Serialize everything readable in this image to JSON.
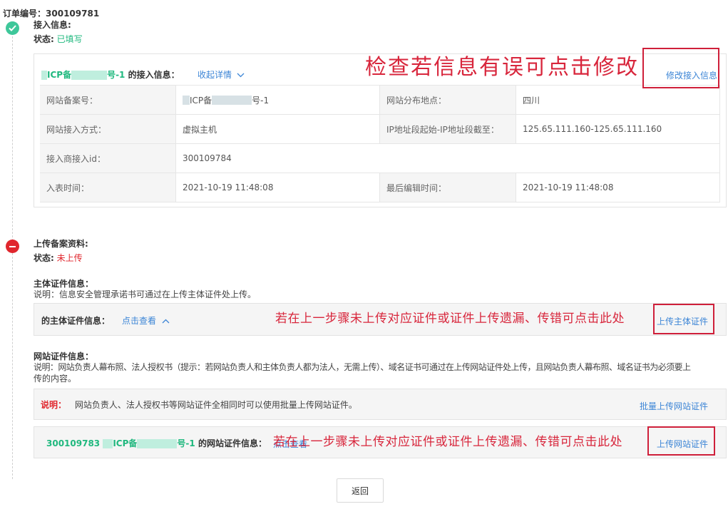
{
  "order": {
    "label": "订单编号：",
    "number": "300109781"
  },
  "step1": {
    "title": "接入信息:",
    "status_label": "状态:",
    "status_value": "已填写",
    "annotation": "检查若信息有误可点击修改",
    "edit_link": "修改接入信息",
    "panel": {
      "title_prefix": "ICP备",
      "title_mid": "号-1",
      "title_suffix": " 的接入信息：",
      "toggle": "收起详情"
    },
    "table": [
      {
        "l1": "网站备案号：",
        "v1a": "ICP备",
        "v1b": "号-1",
        "l2": "网站分布地点：",
        "v2": "四川"
      },
      {
        "l1": "网站接入方式：",
        "v1": "虚拟主机",
        "l2": "IP地址段起始-IP地址段截至：",
        "v2": "125.65.111.160-125.65.111.160"
      },
      {
        "l1": "接入商接入id：",
        "v1": "300109784"
      },
      {
        "l1": "入表时间：",
        "v1": "2021-10-19 11:48:08",
        "l2": "最后编辑时间：",
        "v2": "2021-10-19 11:48:08"
      }
    ]
  },
  "step2": {
    "title": "上传备案资料:",
    "status_label": "状态:",
    "status_value": "未上传",
    "subject": {
      "title": "主体证件信息：",
      "desc": "说明：信息安全管理承诺书可通过在上传主体证件处上传。",
      "row_label": "的主体证件信息：",
      "toggle": "点击查看",
      "annotation": "若在上一步骤未上传对应证件或证件上传遗漏、传错可点击此处",
      "upload": "上传主体证件"
    },
    "website": {
      "title": "网站证件信息：",
      "desc_line1": "说明：网站负责人幕布照、法人授权书（提示：若网站负责人和主体负责人都为法人，无需上传）、域名证书可通过在上传网站证件处上传，且网站负责人幕布照、域名证书为必须要上",
      "desc_line2": "传的内容。",
      "note_label": "说明：",
      "note_text": "网站负责人、法人授权书等网站证件全相同时可以使用批量上传网站证件。",
      "batch_upload": "批量上传网站证件",
      "row_id": "300109783",
      "row_icp": "ICP备",
      "row_mid": "号-1",
      "row_suffix": " 的网站证件信息：",
      "toggle": "点击查看",
      "annotation": "若在上一步骤未上传对应证件或证件上传遗漏、传错可点击此处",
      "upload": "上传网站证件"
    }
  },
  "back_button": "返回",
  "colors": {
    "accent_green": "#1fb87e",
    "error_red": "#e0262d",
    "link_blue": "#3c85d6",
    "annotation_red": "#d8263c"
  }
}
